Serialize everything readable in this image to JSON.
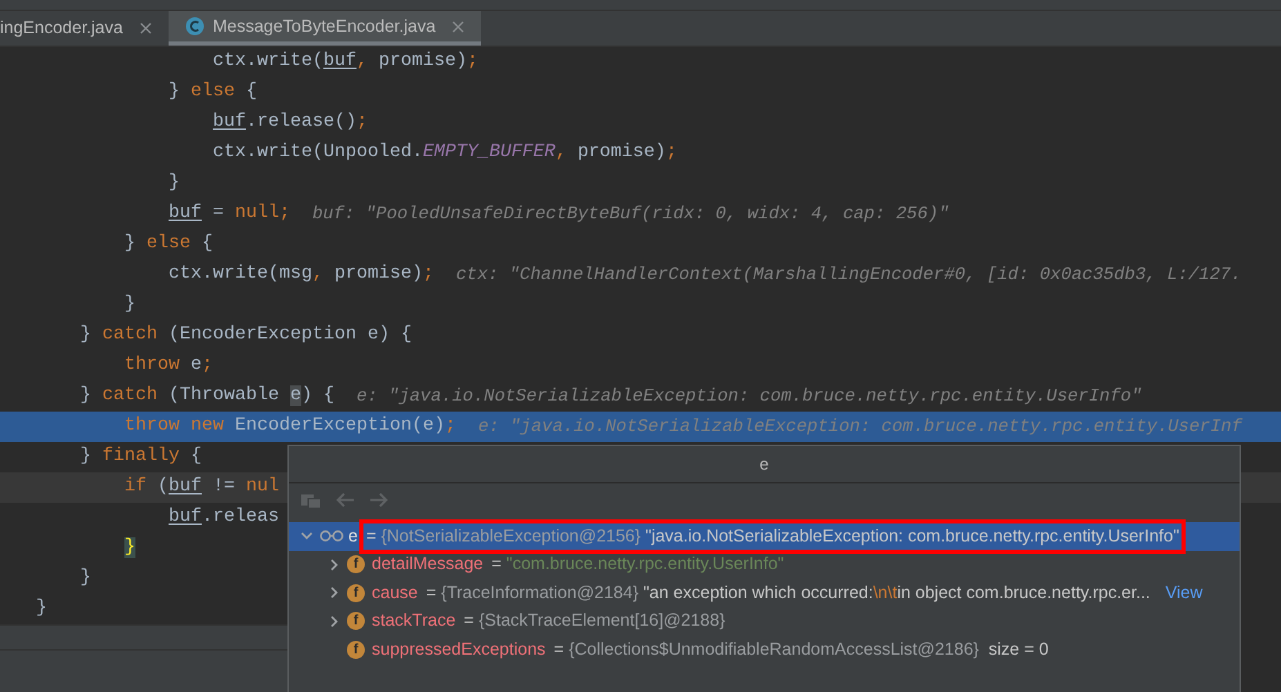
{
  "tabs": [
    {
      "label": "ingEncoder.java",
      "selected": false,
      "class_icon": false
    },
    {
      "label": "MessageToByteEncoder.java",
      "selected": true,
      "class_icon": true
    }
  ],
  "code_lines": [
    {
      "execution_point": false,
      "caret_line": false,
      "code": [
        {
          "t": "                ctx.write(",
          "kind": "text"
        },
        {
          "t": "buf",
          "kind": "underlined"
        },
        {
          "t": ",",
          "kind": "punct"
        },
        {
          "t": " promise)",
          "kind": "text"
        },
        {
          "t": ";",
          "kind": "punct"
        }
      ]
    },
    {
      "execution_point": false,
      "caret_line": false,
      "code": [
        {
          "t": "            } ",
          "kind": "text"
        },
        {
          "t": "else",
          "kind": "keyword"
        },
        {
          "t": " {",
          "kind": "text"
        }
      ]
    },
    {
      "execution_point": false,
      "caret_line": false,
      "code": [
        {
          "t": "                buf",
          "kind": "underlined"
        },
        {
          "t": ".release()",
          "kind": "text"
        },
        {
          "t": ";",
          "kind": "punct"
        }
      ]
    },
    {
      "execution_point": false,
      "caret_line": false,
      "code": [
        {
          "t": "                ctx.write(Unpooled.",
          "kind": "text"
        },
        {
          "t": "EMPTY_BUFFER",
          "kind": "constant"
        },
        {
          "t": ",",
          "kind": "punct"
        },
        {
          "t": " promise)",
          "kind": "text"
        },
        {
          "t": ";",
          "kind": "punct"
        }
      ]
    },
    {
      "execution_point": false,
      "caret_line": false,
      "code": [
        {
          "t": "            }",
          "kind": "text"
        }
      ]
    },
    {
      "execution_point": false,
      "caret_line": false,
      "code": [
        {
          "t": "            buf",
          "kind": "underlined"
        },
        {
          "t": " = ",
          "kind": "text"
        },
        {
          "t": "null",
          "kind": "keyword"
        },
        {
          "t": ";",
          "kind": "punct"
        }
      ],
      "hint": "buf: \"PooledUnsafeDirectByteBuf(ridx: 0, widx: 4, cap: 256)\""
    },
    {
      "execution_point": false,
      "caret_line": false,
      "code": [
        {
          "t": "        } ",
          "kind": "text"
        },
        {
          "t": "else",
          "kind": "keyword"
        },
        {
          "t": " {",
          "kind": "text"
        }
      ]
    },
    {
      "execution_point": false,
      "caret_line": false,
      "code": [
        {
          "t": "            ctx.write(msg",
          "kind": "text"
        },
        {
          "t": ",",
          "kind": "punct"
        },
        {
          "t": " promise)",
          "kind": "text"
        },
        {
          "t": ";",
          "kind": "punct"
        }
      ],
      "hint": "ctx: \"ChannelHandlerContext(MarshallingEncoder#0, [id: 0x0ac35db3, L:/127."
    },
    {
      "execution_point": false,
      "caret_line": false,
      "code": [
        {
          "t": "        }",
          "kind": "text"
        }
      ]
    },
    {
      "execution_point": false,
      "caret_line": false,
      "code": [
        {
          "t": "    } ",
          "kind": "text"
        },
        {
          "t": "catch",
          "kind": "keyword"
        },
        {
          "t": " (EncoderException e) {",
          "kind": "text"
        }
      ]
    },
    {
      "execution_point": false,
      "caret_line": false,
      "code": [
        {
          "t": "        throw",
          "kind": "keyword"
        },
        {
          "t": " e",
          "kind": "text"
        },
        {
          "t": ";",
          "kind": "punct"
        }
      ]
    },
    {
      "execution_point": false,
      "caret_line": false,
      "code": [
        {
          "t": "    } ",
          "kind": "text"
        },
        {
          "t": "catch",
          "kind": "keyword"
        },
        {
          "t": " (Throwable ",
          "kind": "text"
        },
        {
          "t": "e",
          "kind": "caret"
        },
        {
          "t": ") {",
          "kind": "text"
        }
      ],
      "hint": "e: \"java.io.NotSerializableException: com.bruce.netty.rpc.entity.UserInfo\""
    },
    {
      "execution_point": true,
      "caret_line": false,
      "code": [
        {
          "t": "        throw",
          "kind": "keyword"
        },
        {
          "t": " new",
          "kind": "keyword"
        },
        {
          "t": " EncoderException(e)",
          "kind": "text"
        },
        {
          "t": ";",
          "kind": "punct"
        }
      ],
      "hint": "e: \"java.io.NotSerializableException: com.bruce.netty.rpc.entity.UserInf"
    },
    {
      "execution_point": false,
      "caret_line": false,
      "code": [
        {
          "t": "    } ",
          "kind": "text"
        },
        {
          "t": "finally",
          "kind": "keyword"
        },
        {
          "t": " {",
          "kind": "text"
        }
      ]
    },
    {
      "execution_point": false,
      "caret_line": true,
      "code": [
        {
          "t": "        if",
          "kind": "keyword"
        },
        {
          "t": " (",
          "kind": "text"
        },
        {
          "t": "buf",
          "kind": "underlined"
        },
        {
          "t": " != ",
          "kind": "text"
        },
        {
          "t": "nul",
          "kind": "keyword"
        }
      ]
    },
    {
      "execution_point": false,
      "caret_line": false,
      "code": [
        {
          "t": "            buf",
          "kind": "underlined"
        },
        {
          "t": ".releas",
          "kind": "text"
        }
      ]
    },
    {
      "execution_point": false,
      "caret_line": false,
      "code": [
        {
          "t": "        }",
          "kind": "brace-match"
        }
      ]
    },
    {
      "execution_point": false,
      "caret_line": false,
      "code": [
        {
          "t": "    }",
          "kind": "text"
        }
      ]
    },
    {
      "execution_point": false,
      "caret_line": false,
      "code": [
        {
          "t": "}",
          "kind": "text"
        }
      ]
    }
  ],
  "popup": {
    "title": "e",
    "tree": [
      {
        "name": "e",
        "kind": "branch",
        "expanded": true,
        "selected": true,
        "annotated": true,
        "value": [
          {
            "t": "= ",
            "kind": "plain"
          },
          {
            "t": "{NotSerializableException@2156}",
            "kind": "ref"
          },
          {
            "t": " \"java.io.NotSerializableException: com.bruce.netty.rpc.entity.UserInfo\"",
            "kind": "plain"
          }
        ],
        "children": [
          {
            "name": "detailMessage",
            "badge": "f",
            "kind": "branch",
            "expanded": false,
            "selected": false,
            "annotated": false,
            "value": [
              {
                "t": "= ",
                "kind": "plain"
              },
              {
                "t": "\"com.bruce.netty.rpc.entity.UserInfo\"",
                "kind": "string"
              }
            ]
          },
          {
            "name": "cause",
            "badge": "f",
            "kind": "branch",
            "expanded": false,
            "selected": false,
            "annotated": false,
            "value": [
              {
                "t": "= ",
                "kind": "plain"
              },
              {
                "t": "{TraceInformation@2184}",
                "kind": "ref"
              },
              {
                "t": " \"an exception which occurred:",
                "kind": "plain"
              },
              {
                "t": "\\n\\t",
                "kind": "escape"
              },
              {
                "t": "in object com.bruce.netty.rpc.er...",
                "kind": "plain"
              }
            ],
            "link": "View"
          },
          {
            "name": "stackTrace",
            "badge": "f",
            "kind": "branch",
            "expanded": false,
            "selected": false,
            "annotated": false,
            "value": [
              {
                "t": "= ",
                "kind": "plain"
              },
              {
                "t": "{StackTraceElement[16]@2188}",
                "kind": "ref"
              }
            ]
          },
          {
            "name": "suppressedExceptions",
            "badge": "f",
            "kind": "leaf",
            "selected": false,
            "annotated": false,
            "value": [
              {
                "t": "= ",
                "kind": "plain"
              },
              {
                "t": "{Collections$UnmodifiableRandomAccessList@2186}",
                "kind": "ref"
              },
              {
                "t": "  size = 0",
                "kind": "plain"
              }
            ]
          }
        ]
      }
    ]
  }
}
